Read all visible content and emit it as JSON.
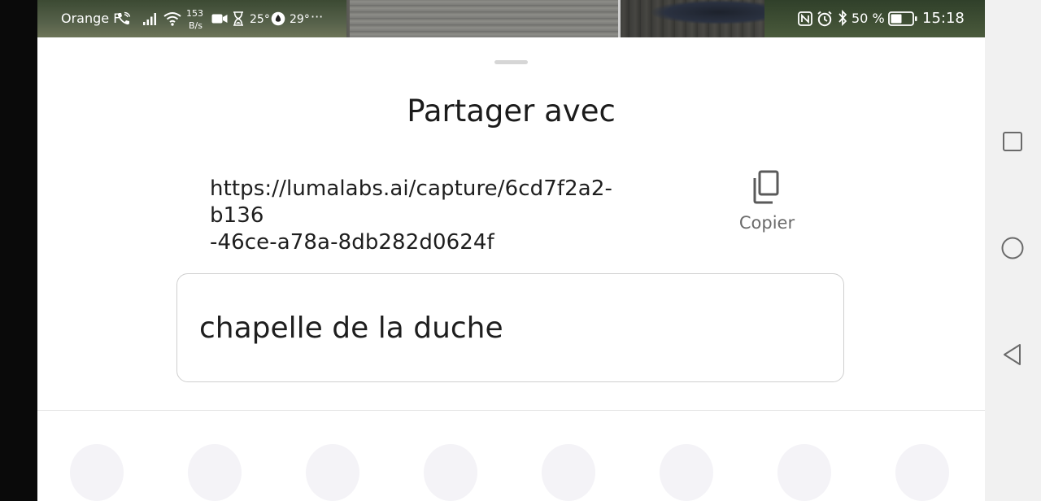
{
  "status_bar": {
    "carrier": "Orange F",
    "net_speed_value": "153",
    "net_speed_unit": "B/s",
    "temp_1": "25°",
    "temp_2": "29°",
    "more": "···",
    "battery_percent": "50 %",
    "time": "15:18"
  },
  "share_sheet": {
    "title": "Partager avec",
    "link_line1": "https://lumalabs.ai/capture/6cd7f2a2-b136",
    "link_line2": "-46ce-a78a-8db282d0624f",
    "copy_label": "Copier",
    "name_value": "chapelle de la duche",
    "app_slot_count": 8
  },
  "nav_bar": {
    "buttons": [
      "recent-apps",
      "home",
      "back"
    ]
  },
  "colors": {
    "sheet_bg": "#ffffff",
    "nav_bar_bg": "#f1f1f1",
    "text_primary": "#1b1b1b",
    "text_secondary": "#6b6b6b",
    "app_placeholder": "#f4f3f7"
  }
}
